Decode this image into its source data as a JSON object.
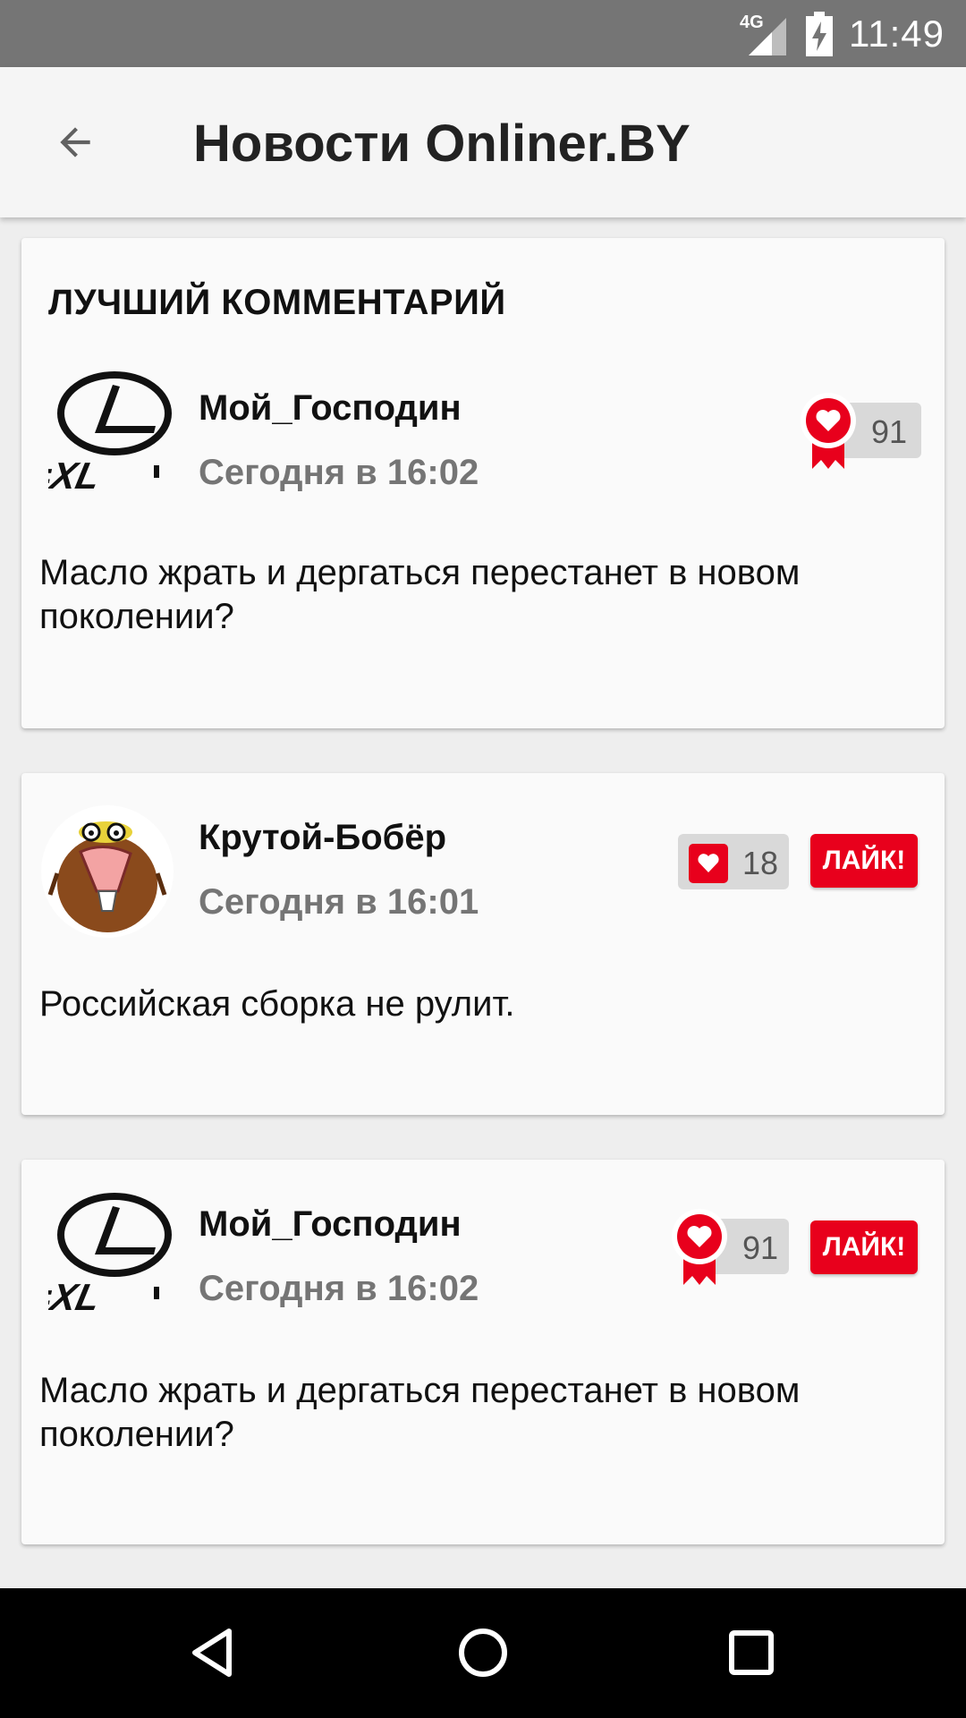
{
  "status_bar": {
    "network": "4G",
    "time": "11:49"
  },
  "app_bar": {
    "title": "Новости Onliner.BY",
    "back_icon": "arrow-back-icon"
  },
  "colors": {
    "accent": "#e8001c",
    "muted_text": "#757575",
    "status_bar": "#757575",
    "card_bg": "#fafafa"
  },
  "best_comment": {
    "heading": "ЛУЧШИЙ КОММЕНТАРИЙ",
    "author": "Мой_Господин",
    "timestamp": "Сегодня в 16:02",
    "text": "Масло жрать и дергаться перестанет в новом поколении?",
    "likes": "91",
    "avatar_icon": "lexus-logo-avatar",
    "badge_icon": "award-heart-icon"
  },
  "comments": [
    {
      "author": "Крутой-Бобёр",
      "timestamp": "Сегодня в 16:01",
      "text": "Российская сборка не рулит.",
      "likes": "18",
      "like_button": "ЛАЙК!",
      "avatar_icon": "beaver-cartoon-avatar",
      "badge_icon": "heart-icon"
    },
    {
      "author": "Мой_Господин",
      "timestamp": "Сегодня в 16:02",
      "text": "Масло жрать и дергаться перестанет в новом поколении?",
      "likes": "91",
      "like_button": "ЛАЙК!",
      "avatar_icon": "lexus-logo-avatar",
      "badge_icon": "award-heart-icon"
    }
  ],
  "nav_bar": {
    "back_icon": "nav-back-icon",
    "home_icon": "nav-home-icon",
    "recents_icon": "nav-recents-icon"
  }
}
